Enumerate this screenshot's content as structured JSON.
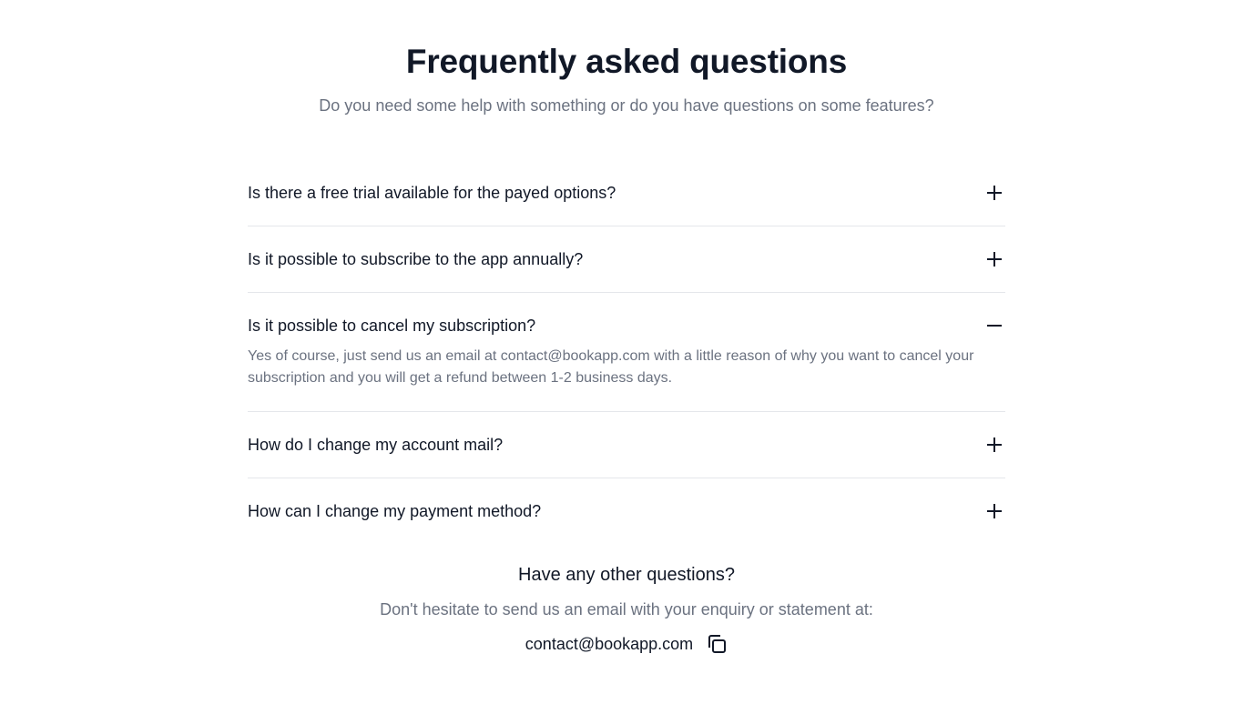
{
  "header": {
    "title": "Frequently asked questions",
    "subtitle": "Do you need some help with something or do you have questions on some features?"
  },
  "faq": {
    "items": [
      {
        "question": "Is there a free trial available for the payed options?",
        "expanded": false,
        "icon": "plus-icon"
      },
      {
        "question": "Is it possible to subscribe to the app annually?",
        "expanded": false,
        "icon": "plus-icon"
      },
      {
        "question": "Is it possible to cancel my subscription?",
        "expanded": true,
        "icon": "minus-icon",
        "answer": "Yes of course, just send us an email at contact@bookapp.com with a little reason of why you want to cancel your subscription and you will get a refund between 1-2 business days."
      },
      {
        "question": "How do I change my account mail?",
        "expanded": false,
        "icon": "plus-icon"
      },
      {
        "question": "How can I change my payment method?",
        "expanded": false,
        "icon": "plus-icon"
      }
    ]
  },
  "footer": {
    "title": "Have any other questions?",
    "text": "Don't hesitate to send us an email with your enquiry or statement at:",
    "email": "contact@bookapp.com",
    "copy_icon": "copy-icon"
  },
  "colors": {
    "text_primary": "#111827",
    "text_secondary": "#6b7280",
    "divider": "#e5e7eb"
  }
}
